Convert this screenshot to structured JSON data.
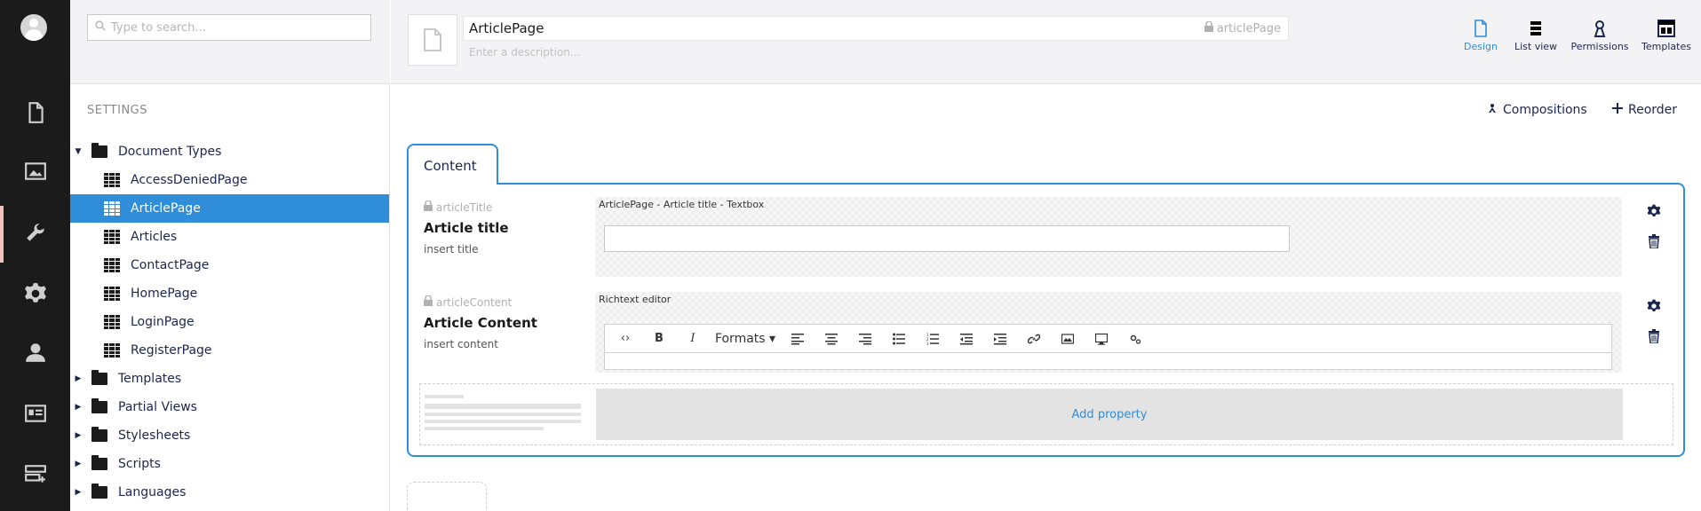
{
  "sidebar": {
    "icons": [
      "avatar-icon",
      "content-icon",
      "media-icon",
      "settings-icon",
      "gear-icon",
      "user-icon",
      "members-icon",
      "forms-icon"
    ],
    "active": "settings"
  },
  "tree": {
    "search_placeholder": "Type to search...",
    "section_title": "SETTINGS",
    "items": [
      {
        "label": "Document Types",
        "type": "folder",
        "expanded": true,
        "level": 0
      },
      {
        "label": "AccessDeniedPage",
        "type": "doctype",
        "level": 1
      },
      {
        "label": "ArticlePage",
        "type": "doctype",
        "level": 1,
        "selected": true
      },
      {
        "label": "Articles",
        "type": "doctype",
        "level": 1
      },
      {
        "label": "ContactPage",
        "type": "doctype",
        "level": 1
      },
      {
        "label": "HomePage",
        "type": "doctype",
        "level": 1
      },
      {
        "label": "LoginPage",
        "type": "doctype",
        "level": 1
      },
      {
        "label": "RegisterPage",
        "type": "doctype",
        "level": 1
      },
      {
        "label": "Templates",
        "type": "folder",
        "level": 0
      },
      {
        "label": "Partial Views",
        "type": "folder",
        "level": 0
      },
      {
        "label": "Stylesheets",
        "type": "folder",
        "level": 0
      },
      {
        "label": "Scripts",
        "type": "folder",
        "level": 0
      },
      {
        "label": "Languages",
        "type": "folder",
        "level": 0
      }
    ]
  },
  "header": {
    "name": "ArticlePage",
    "alias": "articlePage",
    "description_placeholder": "Enter a description...",
    "apps": [
      {
        "label": "Design",
        "icon": "document-icon",
        "active": true
      },
      {
        "label": "List view",
        "icon": "list-icon"
      },
      {
        "label": "Permissions",
        "icon": "keyhole-icon"
      },
      {
        "label": "Templates",
        "icon": "layout-icon"
      }
    ]
  },
  "toolbar": {
    "compositions_label": "Compositions",
    "reorder_label": "Reorder"
  },
  "tab": {
    "label": "Content"
  },
  "properties": [
    {
      "alias": "articleTitle",
      "name": "Article title",
      "description": "insert title",
      "editor_label": "ArticlePage - Article title - Textbox"
    },
    {
      "alias": "articleContent",
      "name": "Article Content",
      "description": "insert content",
      "editor_label": "Richtext editor"
    }
  ],
  "rte": {
    "formats_label": "Formats"
  },
  "add_property_label": "Add property",
  "colors": {
    "accent": "#2f8dd9",
    "rail": "#1b1b1b",
    "header_bg": "#f3f3f5"
  }
}
